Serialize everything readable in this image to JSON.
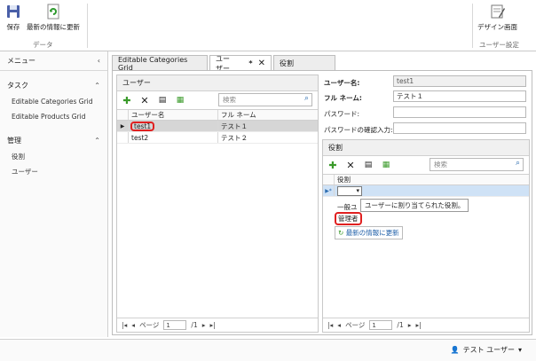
{
  "ribbon": {
    "save_label": "保存",
    "refresh_label": "最新の情報に更新",
    "data_group": "データ",
    "design_label": "デザイン画面",
    "user_settings_group": "ユーザー設定"
  },
  "nav": {
    "menu_label": "メニュー",
    "tasks_label": "タスク",
    "tasks": [
      "Editable Categories Grid",
      "Editable Products Grid"
    ],
    "admin_label": "管理",
    "admin_items": [
      "役割",
      "ユーザー"
    ]
  },
  "tabs": [
    {
      "label": "Editable Categories Grid"
    },
    {
      "label": "ユーザー",
      "modified": "*",
      "close": "✕"
    },
    {
      "label": "役割"
    }
  ],
  "users_panel": {
    "title": "ユーザー",
    "search_placeholder": "検索",
    "columns": [
      "ユーザー名",
      "フル ネーム"
    ],
    "rows": [
      {
        "username": "test1",
        "fullname": "テスト１"
      },
      {
        "username": "test2",
        "fullname": "テスト２"
      }
    ],
    "pager_label": "ページ",
    "page": "1",
    "page_total": "/1"
  },
  "detail": {
    "username_label": "ユーザー名:",
    "username_value": "test1",
    "fullname_label": "フル ネーム:",
    "fullname_value": "テスト１",
    "password_label": "パスワード:",
    "confirm_label": "パスワードの確認入力:"
  },
  "roles_panel": {
    "title": "役割",
    "search_placeholder": "検索",
    "column": "役割",
    "tooltip": "ユーザーに割り当てられた役割。",
    "option_general": "一般ユ",
    "option_admin": "管理者",
    "refresh_link": "最新の情報に更新",
    "pager_label": "ページ",
    "page": "1",
    "page_total": "/1"
  },
  "status": {
    "current_user": "テスト ユーザー"
  }
}
